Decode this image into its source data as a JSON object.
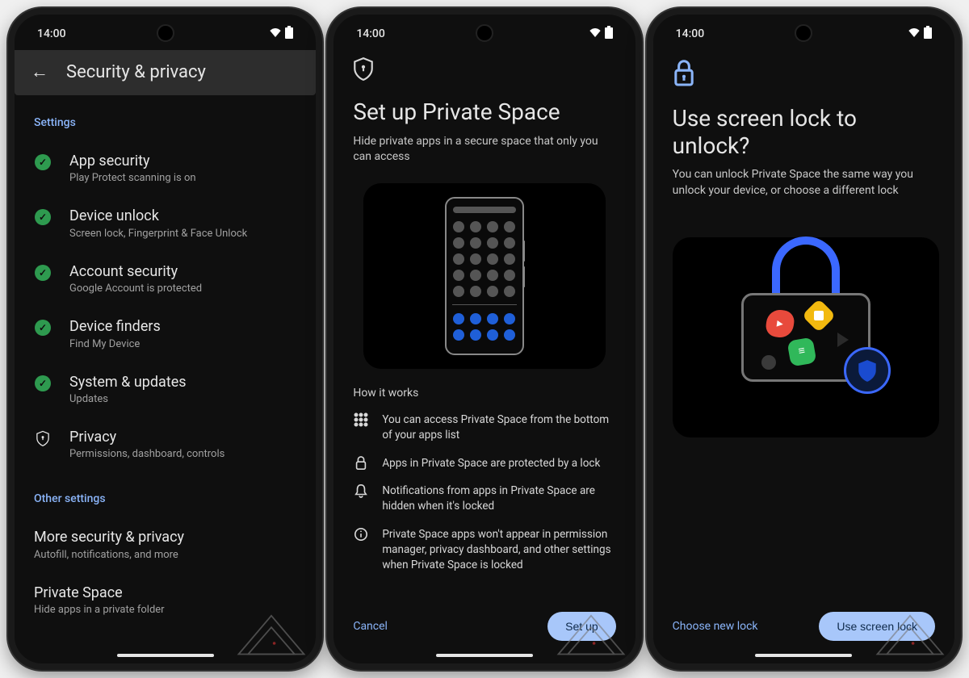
{
  "status": {
    "time": "14:00"
  },
  "screen1": {
    "title": "Security & privacy",
    "section_settings": "Settings",
    "settings": [
      {
        "title": "App security",
        "sub": "Play Protect scanning is on",
        "icon": "check"
      },
      {
        "title": "Device unlock",
        "sub": "Screen lock, Fingerprint & Face Unlock",
        "icon": "check"
      },
      {
        "title": "Account security",
        "sub": "Google Account is protected",
        "icon": "check"
      },
      {
        "title": "Device finders",
        "sub": "Find My Device",
        "icon": "check"
      },
      {
        "title": "System & updates",
        "sub": "Updates",
        "icon": "check"
      },
      {
        "title": "Privacy",
        "sub": "Permissions, dashboard, controls",
        "icon": "shield"
      }
    ],
    "section_other": "Other settings",
    "other": [
      {
        "title": "More security & privacy",
        "sub": "Autofill, notifications, and more"
      },
      {
        "title": "Private Space",
        "sub": "Hide apps in a private folder"
      }
    ]
  },
  "screen2": {
    "title": "Set up Private Space",
    "lead": "Hide private apps in a secure space that only you can access",
    "how_label": "How it works",
    "how": [
      {
        "icon": "grid",
        "text": "You can access Private Space from the bottom of your apps list"
      },
      {
        "icon": "lock",
        "text": "Apps in Private Space are protected by a lock"
      },
      {
        "icon": "bell",
        "text": "Notifications from apps in Private Space are hidden when it's locked"
      },
      {
        "icon": "info",
        "text": "Private Space apps won't appear in permission manager, privacy dashboard, and other settings when Private Space is locked"
      }
    ],
    "cancel": "Cancel",
    "setup": "Set up"
  },
  "screen3": {
    "title": "Use screen lock to unlock?",
    "lead": "You can unlock Private Space the same way you unlock your device, or choose a different lock",
    "choose": "Choose new lock",
    "use": "Use screen lock"
  }
}
